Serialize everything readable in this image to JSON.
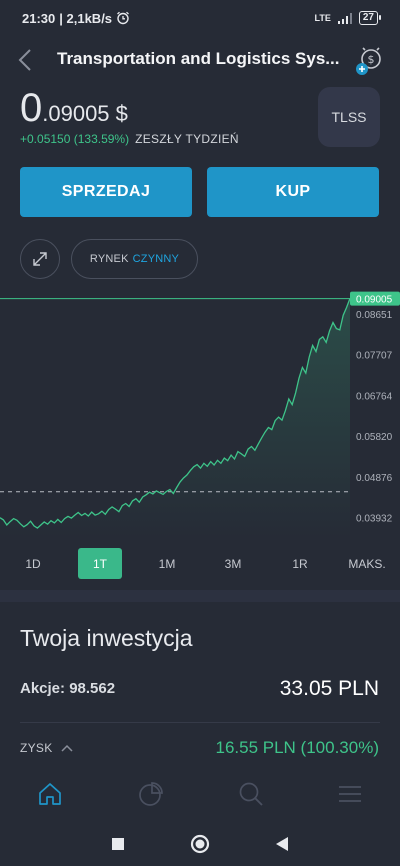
{
  "status_bar": {
    "time": "21:30",
    "speed": "| 2,1kB/s",
    "network": "LTE",
    "battery": "27"
  },
  "header": {
    "title": "Transportation and Logistics Sys..."
  },
  "quote": {
    "price_int": "0",
    "price_frac": ".09005 $",
    "change": "+0.05150 (133.59%)",
    "period": "ZESZŁY TYDZIEŃ",
    "ticker": "TLSS"
  },
  "actions": {
    "sell": "SPRZEDAJ",
    "buy": "KUP"
  },
  "market": {
    "label": "RYNEK",
    "status": "CZYNNY"
  },
  "chart_data": {
    "type": "area",
    "y_ticks": [
      "0.09005",
      "0.08651",
      "0.07707",
      "0.06764",
      "0.05820",
      "0.04876",
      "0.03932"
    ],
    "current_value": 0.09005,
    "reference_value": 0.04531,
    "ylim": [
      0.0346,
      0.0925
    ],
    "colors": {
      "line": "#3ec48a",
      "current_line": "#3ec48a",
      "reference_line": "#b8bcc4"
    },
    "y": [
      0.0393,
      0.0388,
      0.0376,
      0.0384,
      0.0391,
      0.0387,
      0.0379,
      0.0372,
      0.0377,
      0.0385,
      0.0374,
      0.0369,
      0.0376,
      0.0383,
      0.0378,
      0.0386,
      0.0381,
      0.0389,
      0.0382,
      0.0391,
      0.0396,
      0.0392,
      0.0399,
      0.0405,
      0.0398,
      0.0403,
      0.0397,
      0.0406,
      0.0399,
      0.0402,
      0.0408,
      0.0401,
      0.0412,
      0.0418,
      0.0413,
      0.0407,
      0.0421,
      0.0426,
      0.0419,
      0.0432,
      0.0437,
      0.0429,
      0.0441,
      0.0446,
      0.0452,
      0.0448,
      0.0455,
      0.0451,
      0.0447,
      0.0454,
      0.0458,
      0.0449,
      0.0463,
      0.0476,
      0.0485,
      0.0492,
      0.0502,
      0.0511,
      0.0516,
      0.0508,
      0.0519,
      0.0512,
      0.0523,
      0.0515,
      0.0526,
      0.0519,
      0.0531,
      0.0525,
      0.0538,
      0.0529,
      0.0546,
      0.0541,
      0.0535,
      0.0552,
      0.0558,
      0.0549,
      0.0564,
      0.0578,
      0.0591,
      0.0602,
      0.0597,
      0.0618,
      0.0626,
      0.0619,
      0.0641,
      0.0668,
      0.0655,
      0.0682,
      0.0716,
      0.0741,
      0.0728,
      0.0765,
      0.0792,
      0.0778,
      0.0806,
      0.0812,
      0.0799,
      0.0826,
      0.0845,
      0.0831,
      0.0828,
      0.0862,
      0.088,
      0.0901
    ]
  },
  "ranges": [
    "1D",
    "1T",
    "1M",
    "3M",
    "1R",
    "MAKS."
  ],
  "active_range": "1T",
  "investment": {
    "title": "Twoja inwestycja",
    "shares": "Akcje: 98.562",
    "value": "33.05 PLN",
    "profit_label": "ZYSK",
    "profit_value": "16.55 PLN (100.30%)"
  },
  "nav": [
    "home-icon",
    "portfolio-icon",
    "search-icon",
    "menu-icon"
  ]
}
